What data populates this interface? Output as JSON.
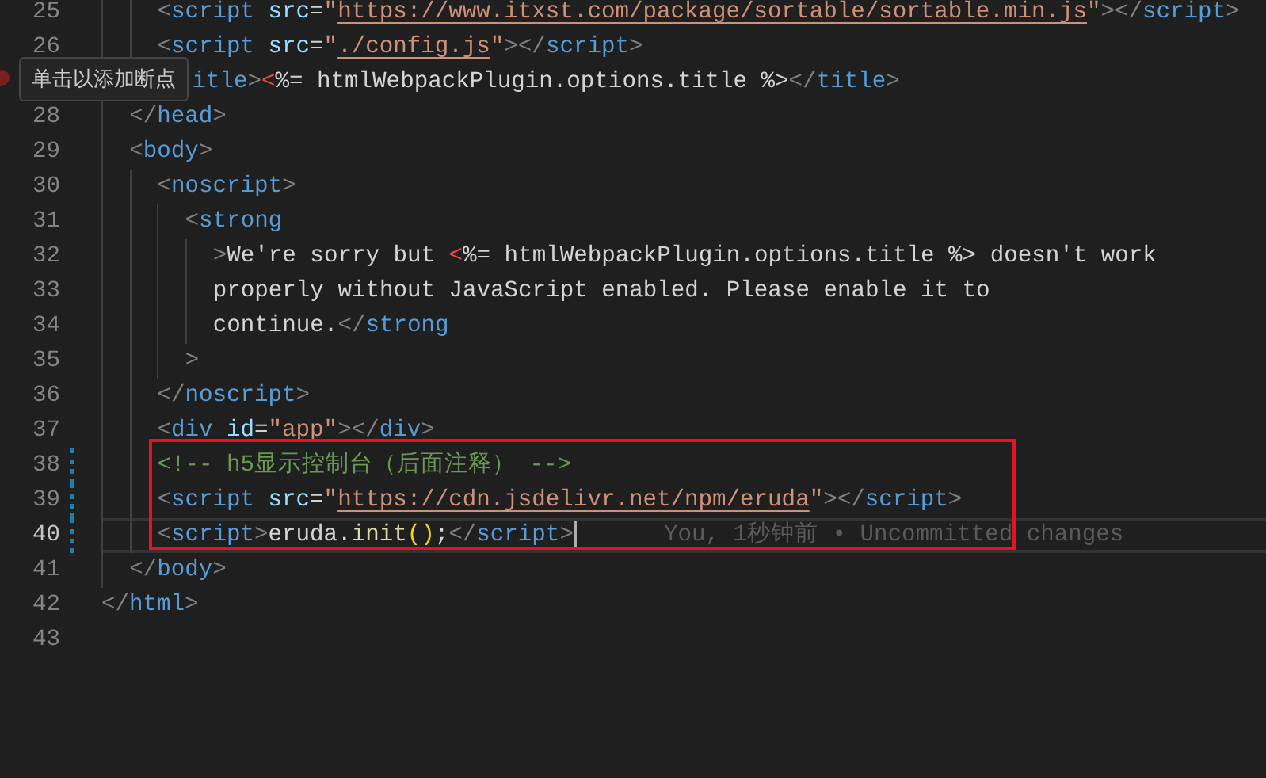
{
  "editor": {
    "lines": [
      {
        "children": [
          {
            "children": [
              {
                "number": "25",
                "active": false,
                "modified": false,
                "tokens": [
                  {
                    "kind": "bracket",
                    "text": "<"
                  },
                  {
                    "kind": "tag",
                    "text": "script"
                  },
                  {
                    "kind": "attr",
                    "text": " src"
                  },
                  {
                    "kind": "plain",
                    "text": "="
                  },
                  {
                    "kind": "string",
                    "text": "\""
                  },
                  {
                    "kind": "link",
                    "text": "https://www.itxst.com/package/sortable/sortable.min.js"
                  },
                  {
                    "kind": "string",
                    "text": "\""
                  },
                  {
                    "kind": "bracket",
                    "text": "></"
                  },
                  {
                    "kind": "tag",
                    "text": "script"
                  },
                  {
                    "kind": "bracket",
                    "text": ">"
                  }
                ]
              },
              {
                "number": "26",
                "active": false,
                "modified": false,
                "tokens": [
                  {
                    "kind": "bracket",
                    "text": "<"
                  },
                  {
                    "kind": "tag",
                    "text": "script"
                  },
                  {
                    "kind": "attr",
                    "text": " src"
                  },
                  {
                    "kind": "plain",
                    "text": "="
                  },
                  {
                    "kind": "string",
                    "text": "\""
                  },
                  {
                    "kind": "link",
                    "text": "./config.js"
                  },
                  {
                    "kind": "string",
                    "text": "\""
                  },
                  {
                    "kind": "bracket",
                    "text": "></"
                  },
                  {
                    "kind": "tag",
                    "text": "script"
                  },
                  {
                    "kind": "bracket",
                    "text": ">"
                  }
                ]
              },
              {
                "active": false,
                "modified": false,
                "tokens": [
                  {
                    "kind": "tag",
                    "text": "itle"
                  },
                  {
                    "kind": "bracket",
                    "text": ">"
                  },
                  {
                    "kind": "error",
                    "text": "<"
                  },
                  {
                    "kind": "plain",
                    "text": "%= htmlWebpackPlugin.options.title %>"
                  },
                  {
                    "kind": "bracket",
                    "text": "</"
                  },
                  {
                    "kind": "tag",
                    "text": "title"
                  },
                  {
                    "kind": "bracket",
                    "text": ">"
                  }
                ]
              }
            ]
          },
          {
            "number": "28",
            "active": false,
            "modified": false,
            "tokens": [
              {
                "kind": "bracket",
                "text": "</"
              },
              {
                "kind": "tag",
                "text": "head"
              },
              {
                "kind": "bracket",
                "text": ">"
              }
            ]
          },
          {
            "number": "29",
            "active": false,
            "modified": false,
            "tokens": [
              {
                "kind": "bracket",
                "text": "<"
              },
              {
                "kind": "tag",
                "text": "body"
              },
              {
                "kind": "bracket",
                "text": ">"
              }
            ],
            "children": [
              {
                "number": "30",
                "active": false,
                "modified": false,
                "tokens": [
                  {
                    "kind": "bracket",
                    "text": "<"
                  },
                  {
                    "kind": "tag",
                    "text": "noscript"
                  },
                  {
                    "kind": "bracket",
                    "text": ">"
                  }
                ],
                "children": [
                  {
                    "number": "31",
                    "active": false,
                    "modified": false,
                    "tokens": [
                      {
                        "kind": "bracket",
                        "text": "<"
                      },
                      {
                        "kind": "tag",
                        "text": "strong"
                      }
                    ],
                    "children": [
                      {
                        "number": "32",
                        "active": false,
                        "modified": false,
                        "tokens": [
                          {
                            "kind": "bracket",
                            "text": ">"
                          },
                          {
                            "kind": "plain",
                            "text": "We're sorry but "
                          },
                          {
                            "kind": "error",
                            "text": "<"
                          },
                          {
                            "kind": "plain",
                            "text": "%= htmlWebpackPlugin.options.title %> doesn't work"
                          }
                        ]
                      },
                      {
                        "number": "33",
                        "active": false,
                        "modified": false,
                        "tokens": [
                          {
                            "kind": "plain",
                            "text": "properly without JavaScript enabled. Please enable it to"
                          }
                        ]
                      },
                      {
                        "number": "34",
                        "active": false,
                        "modified": false,
                        "tokens": [
                          {
                            "kind": "plain",
                            "text": "continue."
                          },
                          {
                            "kind": "bracket",
                            "text": "</"
                          },
                          {
                            "kind": "tag",
                            "text": "strong"
                          }
                        ]
                      }
                    ]
                  },
                  {
                    "number": "35",
                    "active": false,
                    "modified": false,
                    "tokens": [
                      {
                        "kind": "bracket",
                        "text": ">"
                      }
                    ]
                  }
                ]
              },
              {
                "number": "36",
                "active": false,
                "modified": false,
                "tokens": [
                  {
                    "kind": "bracket",
                    "text": "</"
                  },
                  {
                    "kind": "tag",
                    "text": "noscript"
                  },
                  {
                    "kind": "bracket",
                    "text": ">"
                  }
                ]
              },
              {
                "number": "37",
                "active": false,
                "modified": false,
                "tokens": [
                  {
                    "kind": "bracket",
                    "text": "<"
                  },
                  {
                    "kind": "tag",
                    "text": "div"
                  },
                  {
                    "kind": "attr",
                    "text": " id"
                  },
                  {
                    "kind": "plain",
                    "text": "="
                  },
                  {
                    "kind": "string",
                    "text": "\"app\""
                  },
                  {
                    "kind": "bracket",
                    "text": "></"
                  },
                  {
                    "kind": "tag",
                    "text": "div"
                  },
                  {
                    "kind": "bracket",
                    "text": ">"
                  }
                ]
              },
              {
                "number": "38",
                "active": false,
                "modified": true,
                "tokens": [
                  {
                    "kind": "comment",
                    "text": "<!-- h5显示控制台（后面注释） -->"
                  }
                ]
              },
              {
                "number": "39",
                "active": false,
                "modified": true,
                "tokens": [
                  {
                    "kind": "bracket",
                    "text": "<"
                  },
                  {
                    "kind": "tag",
                    "text": "script"
                  },
                  {
                    "kind": "attr",
                    "text": " src"
                  },
                  {
                    "kind": "plain",
                    "text": "="
                  },
                  {
                    "kind": "string",
                    "text": "\""
                  },
                  {
                    "kind": "link",
                    "text": "https://cdn.jsdelivr.net/npm/eruda"
                  },
                  {
                    "kind": "string",
                    "text": "\""
                  },
                  {
                    "kind": "bracket",
                    "text": "></"
                  },
                  {
                    "kind": "tag",
                    "text": "script"
                  },
                  {
                    "kind": "bracket",
                    "text": ">"
                  }
                ]
              },
              {
                "number": "40",
                "active": true,
                "modified": true,
                "blame": "You, 1秒钟前 • Uncommitted changes",
                "tokens": [
                  {
                    "kind": "bracket",
                    "text": "<"
                  },
                  {
                    "kind": "tag",
                    "text": "script"
                  },
                  {
                    "kind": "bracket",
                    "text": ">"
                  },
                  {
                    "kind": "plain",
                    "text": "eruda."
                  },
                  {
                    "kind": "function",
                    "text": "init"
                  },
                  {
                    "kind": "paren",
                    "text": "()"
                  },
                  {
                    "kind": "plain",
                    "text": ";"
                  },
                  {
                    "kind": "bracket",
                    "text": "</"
                  },
                  {
                    "kind": "tag",
                    "text": "script"
                  },
                  {
                    "kind": "bracket",
                    "text": ">"
                  }
                ]
              }
            ]
          },
          {
            "number": "41",
            "active": false,
            "modified": false,
            "tokens": [
              {
                "kind": "bracket",
                "text": "</"
              },
              {
                "kind": "tag",
                "text": "body"
              },
              {
                "kind": "bracket",
                "text": ">"
              }
            ]
          }
        ]
      },
      {
        "number": "42",
        "active": false,
        "modified": false,
        "tokens": [
          {
            "kind": "bracket",
            "text": "</"
          },
          {
            "kind": "tag",
            "text": "html"
          },
          {
            "kind": "bracket",
            "text": ">"
          }
        ]
      },
      {
        "number": "43",
        "active": false,
        "modified": false
      }
    ]
  },
  "tooltip": {
    "text": "单击以添加断点"
  }
}
